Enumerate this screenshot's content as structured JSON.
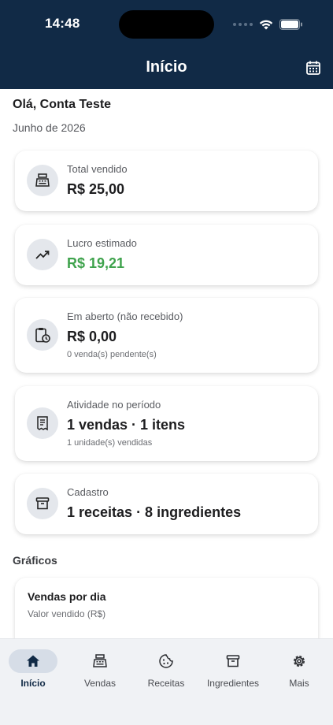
{
  "status_bar": {
    "time": "14:48"
  },
  "header": {
    "title": "Início"
  },
  "greeting": "Olá, Conta Teste",
  "period": "Junho de 2026",
  "cards": [
    {
      "label": "Total vendido",
      "value": "R$ 25,00",
      "icon": "cash-register-icon"
    },
    {
      "label": "Lucro estimado",
      "value": "R$ 19,21",
      "icon": "trending-up-icon",
      "value_color": "#3fa34d"
    },
    {
      "label": "Em aberto (não recebido)",
      "value": "R$ 0,00",
      "sub": "0 venda(s) pendente(s)",
      "icon": "clipboard-clock-icon"
    },
    {
      "label": "Atividade no período",
      "value": "1 vendas · 1 itens",
      "sub": "1 unidade(s) vendidas",
      "icon": "receipt-icon"
    },
    {
      "label": "Cadastro",
      "value": "1 receitas · 8 ingredientes",
      "icon": "archive-box-icon"
    }
  ],
  "charts_section": {
    "title": "Gráficos",
    "chart": {
      "title": "Vendas por dia",
      "subtitle": "Valor vendido (R$)"
    }
  },
  "bottom_nav": [
    {
      "label": "Início",
      "icon": "home-icon",
      "active": true
    },
    {
      "label": "Vendas",
      "icon": "cash-register-icon"
    },
    {
      "label": "Receitas",
      "icon": "cookie-icon"
    },
    {
      "label": "Ingredientes",
      "icon": "archive-box-icon"
    },
    {
      "label": "Mais",
      "icon": "gear-icon"
    }
  ],
  "colors": {
    "header_bg": "#112a46",
    "accent_green": "#3fa34d",
    "nav_bg": "#f0f2f5"
  }
}
